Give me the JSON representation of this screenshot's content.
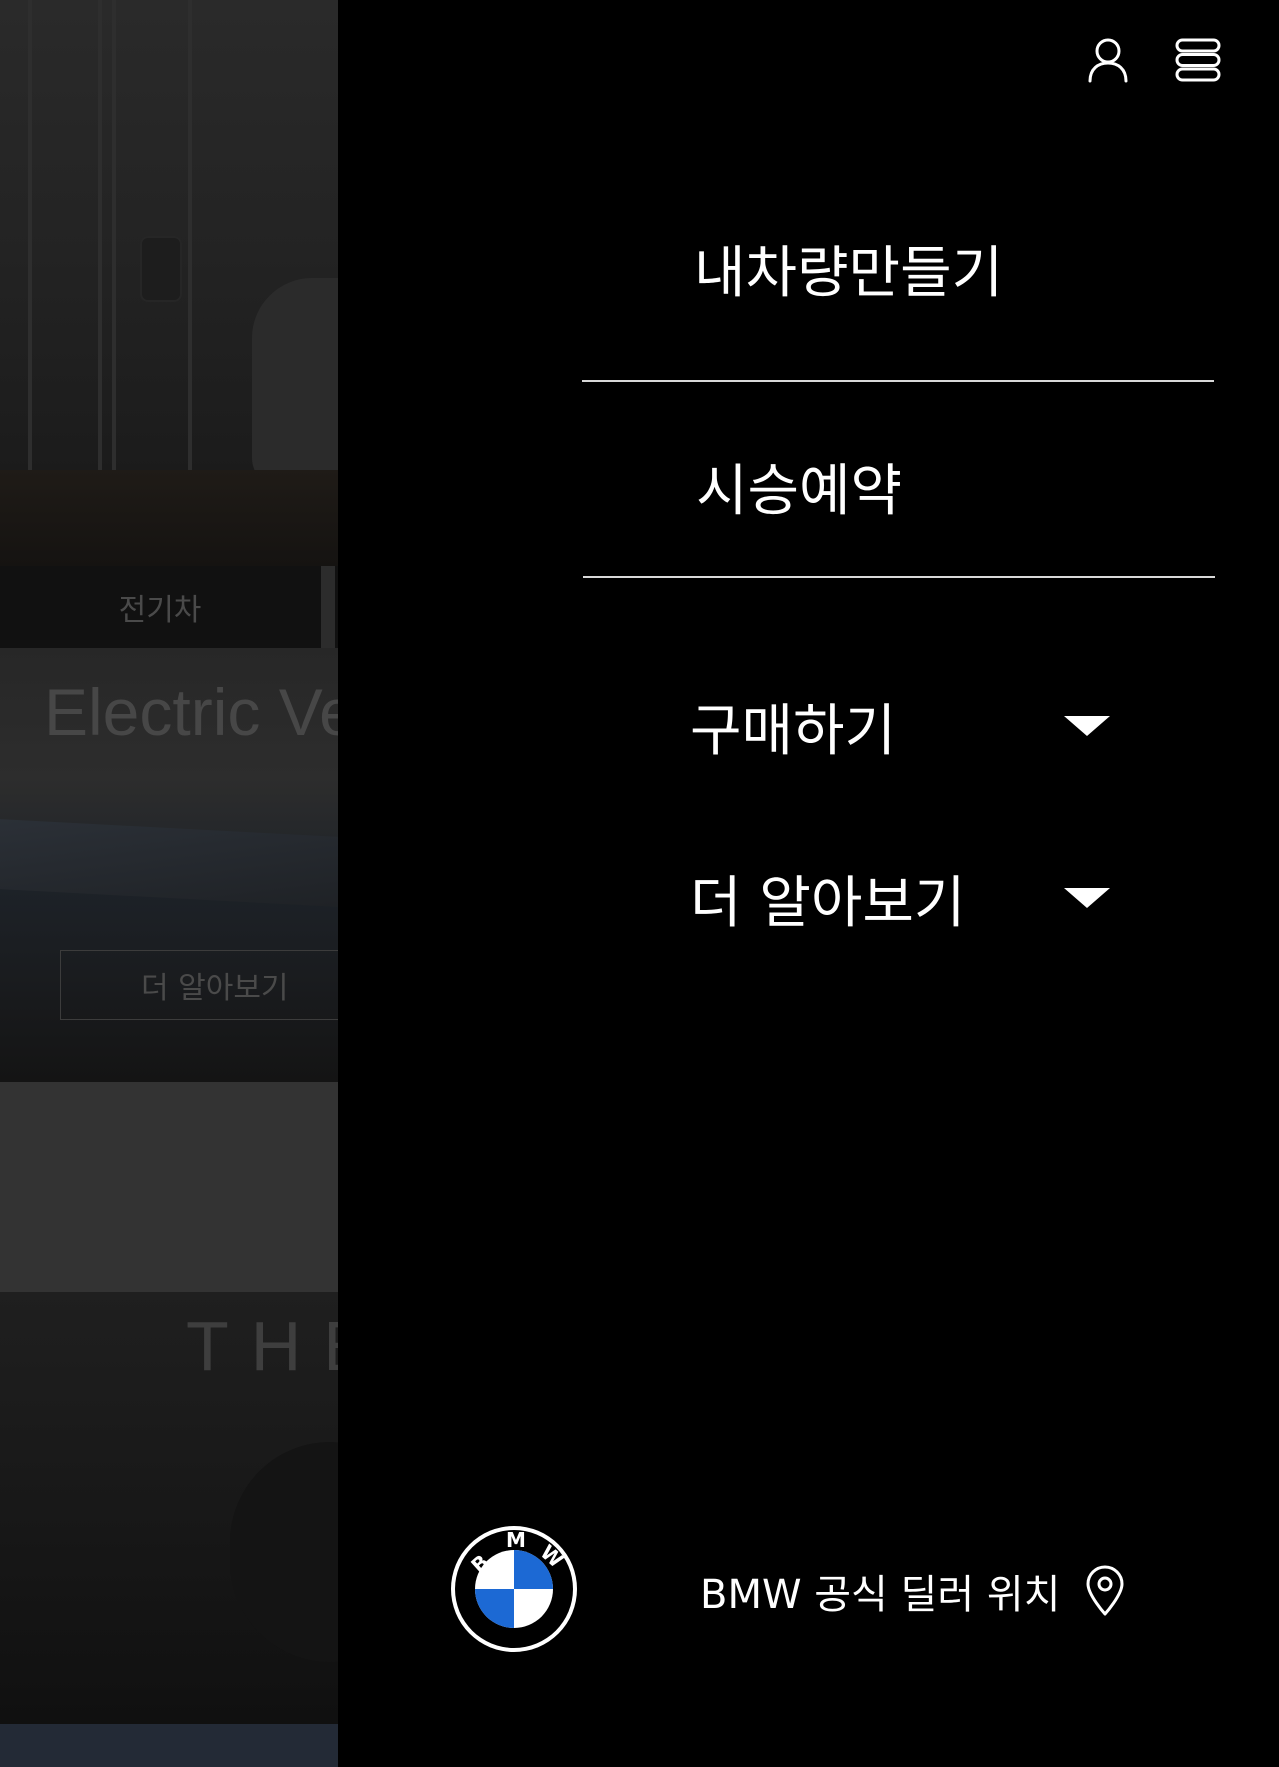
{
  "background": {
    "tab_label": "전기차",
    "ev_heading": "Electric Ve",
    "ev_button_label": "더 알아보기",
    "the_heading": "THE"
  },
  "header": {
    "user_icon": "user-icon",
    "menu_icon": "menu-icon"
  },
  "menu": {
    "primary": [
      {
        "label": "내차량만들기"
      },
      {
        "label": "시승예약"
      }
    ],
    "sections": [
      {
        "label": "구매하기",
        "icon": "caret-down-icon",
        "expanded": false
      },
      {
        "label": "더 알아보기",
        "icon": "caret-down-icon",
        "expanded": false
      }
    ]
  },
  "footer": {
    "logo_letters": "BMW",
    "logo_colors": {
      "blue": "#1c69d4",
      "white": "#ffffff"
    },
    "dealer_label": "BMW 공식 딜러 위치",
    "dealer_icon": "map-pin-icon"
  },
  "colors": {
    "drawer_bg": "#000000",
    "text": "#ffffff",
    "divider": "#d8d8d8"
  }
}
